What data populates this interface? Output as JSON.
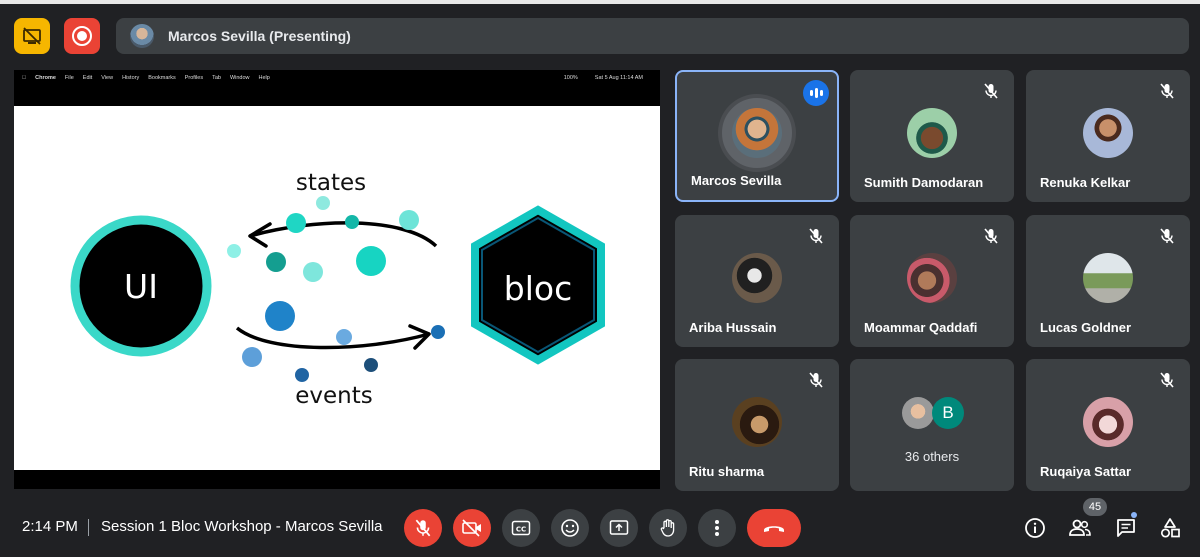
{
  "top_bar": {
    "presenter_label": "Marcos Sevilla (Presenting)"
  },
  "mac_menu": {
    "items": [
      "Chrome",
      "File",
      "Edit",
      "View",
      "History",
      "Bookmarks",
      "Profiles",
      "Tab",
      "Window",
      "Help"
    ],
    "battery": "100%",
    "datetime": "Sat 5 Aug  11:14 AM"
  },
  "slide": {
    "ui_label": "UI",
    "bloc_label": "bloc",
    "states_label": "states",
    "events_label": "events"
  },
  "participants": [
    {
      "name": "Marcos Sevilla",
      "speaking": true
    },
    {
      "name": "Sumith Damodaran",
      "muted": true
    },
    {
      "name": "Renuka Kelkar",
      "muted": true
    },
    {
      "name": "Ariba Hussain",
      "muted": true
    },
    {
      "name": "Moammar Qaddafi",
      "muted": true
    },
    {
      "name": "Lucas Goldner",
      "muted": true
    },
    {
      "name": "Ritu sharma",
      "muted": true
    },
    {
      "name": "36 others",
      "initial": "B"
    },
    {
      "name": "Ruqaiya Sattar",
      "muted": true
    }
  ],
  "bottom_bar": {
    "time": "2:14 PM",
    "meeting_title": "Session 1 Bloc Workshop - Marcos Sevilla",
    "participant_count": "45"
  },
  "colors": {
    "accent_blue": "#1a73e8",
    "danger_red": "#ea4335",
    "tile_bg": "#3c4043",
    "background": "#202124",
    "teal": "#17d4c2",
    "blue": "#1f83c9"
  }
}
